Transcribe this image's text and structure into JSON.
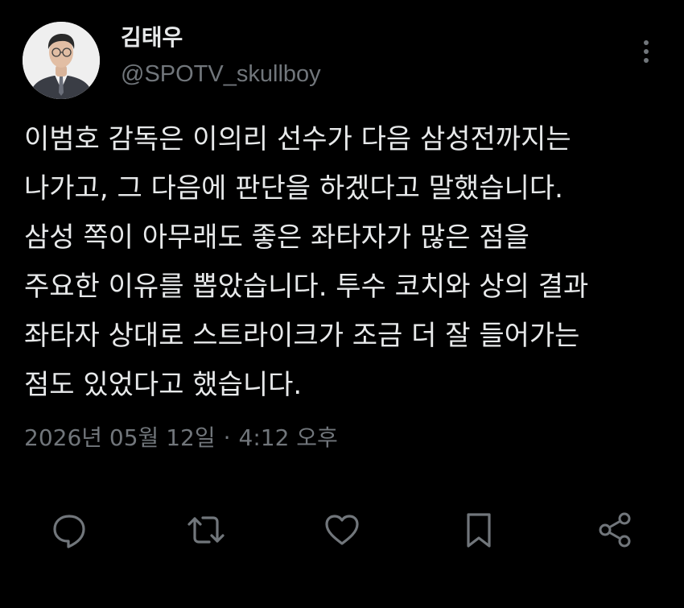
{
  "user": {
    "display_name": "김태우",
    "handle": "@SPOTV_skullboy",
    "avatar_icon": "profile-photo-man-in-suit"
  },
  "tweet": {
    "lines": [
      "이범호 감독은 이의리 선수가 다음 삼성전까지는",
      "나가고, 그 다음에 판단을 하겠다고 말했습니다.",
      "삼성 쪽이 아무래도 좋은 좌타자가 많은 점을",
      "주요한 이유를 뽑았습니다. 투수 코치와 상의 결과",
      "좌타자 상대로 스트라이크가 조금 더 잘 들어가는",
      "점도 있었다고 했습니다."
    ],
    "date": "2026년 05월 12일",
    "separator": "·",
    "time": "4:12 오후"
  },
  "actions": {
    "icons": [
      "reply-icon",
      "retweet-icon",
      "like-icon",
      "bookmark-icon",
      "share-icon"
    ]
  },
  "colors": {
    "background": "#000000",
    "primary_text": "#e7e9ea",
    "secondary_text": "#71767b"
  }
}
